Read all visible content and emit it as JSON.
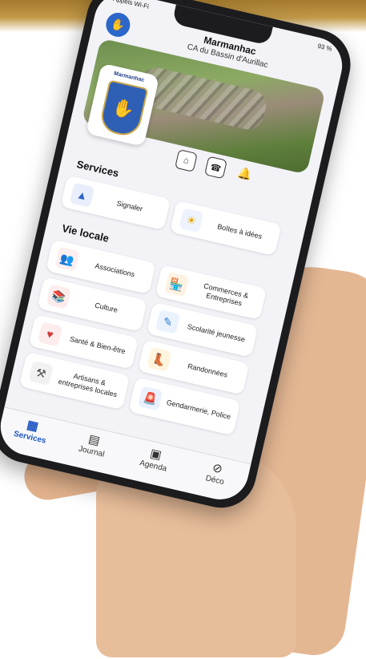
{
  "statusbar": {
    "carrier": "Appels Wi-Fi",
    "battery": "93 %"
  },
  "app": {
    "title": "Marmanhac",
    "subtitle": "CA du Bassin d'Aurillac",
    "crest_label": "Marmanhac"
  },
  "sections": {
    "services": {
      "title": "Services",
      "items": [
        {
          "label": "Signaler",
          "icon": "cone-icon"
        },
        {
          "label": "Boîtes à idées",
          "icon": "lightbulb-icon"
        }
      ]
    },
    "vie_locale": {
      "title": "Vie locale",
      "items": [
        {
          "label": "Associations",
          "icon": "people-icon"
        },
        {
          "label": "Commerces & Entreprises",
          "icon": "shop-icon"
        },
        {
          "label": "Culture",
          "icon": "books-icon"
        },
        {
          "label": "Scolarité jeunesse",
          "icon": "pencil-ruler-icon"
        },
        {
          "label": "Santé & Bien-être",
          "icon": "health-shield-icon"
        },
        {
          "label": "Randonnées",
          "icon": "boot-icon"
        },
        {
          "label": "Artisans & entreprises locales",
          "icon": "hammer-icon"
        },
        {
          "label": "Gendarmerie, Police",
          "icon": "siren-icon"
        }
      ]
    }
  },
  "tabbar": {
    "tabs": [
      {
        "label": "Services",
        "icon": "grid-icon",
        "active": true
      },
      {
        "label": "Journal",
        "icon": "newspaper-icon",
        "active": false
      },
      {
        "label": "Agenda",
        "icon": "calendar-icon",
        "active": false
      },
      {
        "label": "Déco",
        "icon": "compass-icon",
        "active": false
      }
    ]
  },
  "colors": {
    "accent": "#1f57c3",
    "background_band": "#b58b3c"
  }
}
